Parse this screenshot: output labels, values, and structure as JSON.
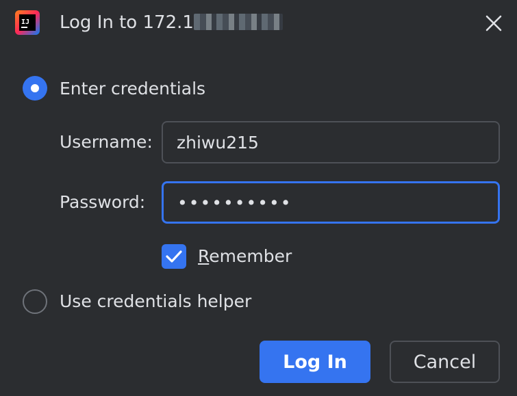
{
  "dialog": {
    "title_prefix": "Log In to 172.1",
    "app_icon": "intellij-idea-icon",
    "close_icon": "close-icon"
  },
  "auth": {
    "enter_credentials_label": "Enter credentials",
    "enter_credentials_selected": true,
    "username_label": "Username:",
    "username_value": "zhiwu215",
    "password_label": "Password:",
    "password_value": "••••••••••",
    "remember_mnemonic": "R",
    "remember_rest": "emember",
    "remember_checked": true,
    "helper_label": "Use credentials helper",
    "helper_selected": false
  },
  "buttons": {
    "login_label": "Log In",
    "cancel_label": "Cancel"
  },
  "colors": {
    "background": "#2b2d30",
    "accent": "#3574f0",
    "text": "#dfe1e5",
    "border": "#4e5157"
  }
}
